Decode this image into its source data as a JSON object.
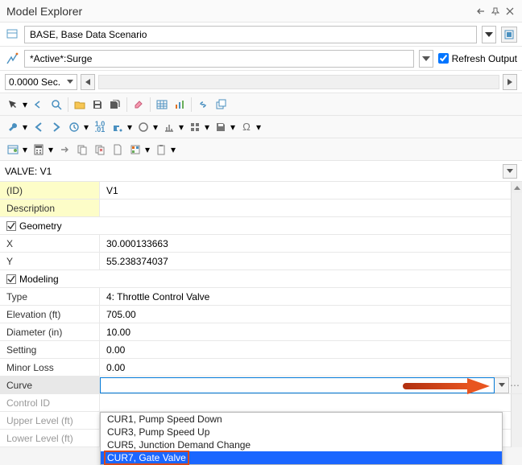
{
  "header": {
    "title": "Model Explorer"
  },
  "scenario": {
    "value": "BASE, Base Data Scenario"
  },
  "analysis": {
    "value": "*Active*:Surge",
    "refresh_label": "Refresh Output",
    "refresh_checked": true
  },
  "time": {
    "value": "0.0000 Sec."
  },
  "element": {
    "label": "VALVE: V1"
  },
  "properties": {
    "id_label": "(ID)",
    "id_value": "V1",
    "description_label": "Description",
    "description_value": "",
    "geometry_label": "Geometry",
    "x_label": "X",
    "x_value": "30.000133663",
    "y_label": "Y",
    "y_value": "55.238374037",
    "modeling_label": "Modeling",
    "type_label": "Type",
    "type_value": "4: Throttle Control Valve",
    "elevation_label": "Elevation (ft)",
    "elevation_value": "705.00",
    "diameter_label": "Diameter (in)",
    "diameter_value": "10.00",
    "setting_label": "Setting",
    "setting_value": "0.00",
    "minor_loss_label": "Minor Loss",
    "minor_loss_value": "0.00",
    "curve_label": "Curve",
    "curve_value": "",
    "control_id_label": "Control ID",
    "upper_level_label": "Upper Level (ft)",
    "lower_level_label": "Lower Level (ft)"
  },
  "curve_options": {
    "o1": "CUR1, Pump Speed Down",
    "o2": "CUR3, Pump Speed Up",
    "o3": "CUR5, Junction Demand Change",
    "o4": "CUR7, Gate Valve"
  }
}
